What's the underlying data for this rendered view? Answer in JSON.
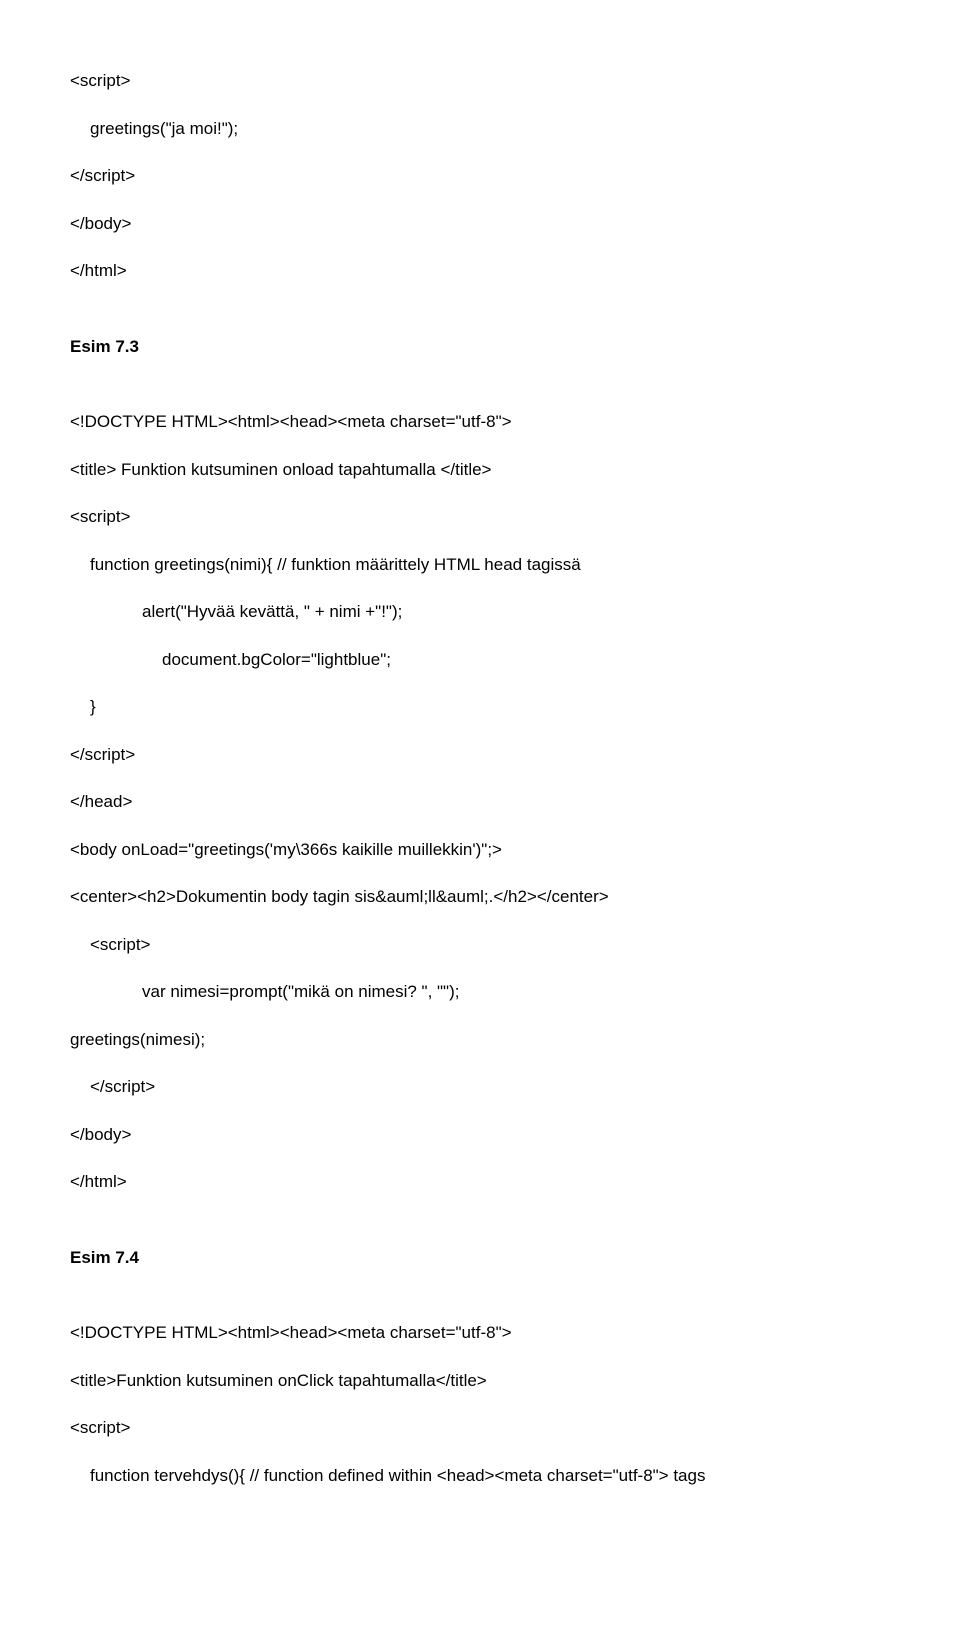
{
  "lines": [
    {
      "text": "<script>",
      "class": "line"
    },
    {
      "text": "greetings(\"ja moi!\");",
      "class": "line indent1"
    },
    {
      "text": "</script>",
      "class": "line"
    },
    {
      "text": "</body>",
      "class": "line"
    },
    {
      "text": "</html>",
      "class": "line"
    },
    {
      "text": "Esim 7.3",
      "class": "line esim"
    },
    {
      "text": "<!DOCTYPE HTML><html><head><meta charset=\"utf-8\">",
      "class": "line"
    },
    {
      "text": "<title> Funktion kutsuminen onload tapahtumalla </title>",
      "class": "line"
    },
    {
      "text": "<script>",
      "class": "line"
    },
    {
      "text": "function greetings(nimi){  // funktion määrittely HTML head tagissä",
      "class": "line indent1"
    },
    {
      "text": "alert(\"Hyvää kevättä, \" + nimi +\"!\");",
      "class": "line indent2"
    },
    {
      "text": "document.bgColor=\"lightblue\";",
      "class": "line indent3"
    },
    {
      "text": "}",
      "class": "line indent1"
    },
    {
      "text": "</script>",
      "class": "line"
    },
    {
      "text": "</head>",
      "class": "line"
    },
    {
      "text": "<body onLoad=\"greetings('my\\366s kaikille muillekkin')\";>",
      "class": "line"
    },
    {
      "text": "<center><h2>Dokumentin body tagin sis&auml;ll&auml;.</h2></center>",
      "class": "line"
    },
    {
      "text": "<script>",
      "class": "line indent1"
    },
    {
      "text": "var nimesi=prompt(\"mikä on nimesi? \", \"\");",
      "class": "line indent2"
    },
    {
      "text": "greetings(nimesi);",
      "class": "line"
    },
    {
      "text": "</script>",
      "class": "line indent1"
    },
    {
      "text": "</body>",
      "class": "line"
    },
    {
      "text": "</html>",
      "class": "line"
    },
    {
      "text": "Esim 7.4",
      "class": "line esim"
    },
    {
      "text": "<!DOCTYPE HTML><html><head><meta charset=\"utf-8\">",
      "class": "line"
    },
    {
      "text": "<title>Funktion kutsuminen onClick tapahtumalla</title>",
      "class": "line"
    },
    {
      "text": "<script>",
      "class": "line"
    },
    {
      "text": "function tervehdys(){ // function defined within <head><meta charset=\"utf-8\"> tags",
      "class": "line indent1"
    }
  ]
}
